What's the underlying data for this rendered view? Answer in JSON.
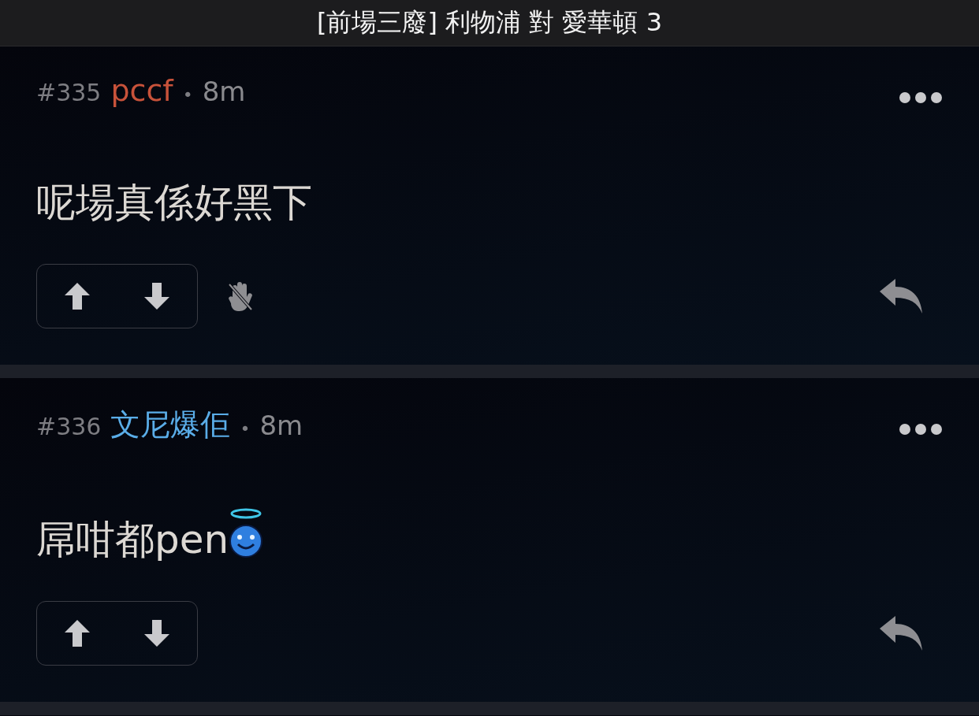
{
  "window": {
    "title": "[前場三廢] 利物浦 對 愛華頓 3"
  },
  "posts": [
    {
      "number": "#335",
      "author": "pccf",
      "color": "#c8523a",
      "separator": "•",
      "time": "8m",
      "text": "呢場真係好黑下",
      "emoji": false,
      "hand_blocked": true
    },
    {
      "number": "#336",
      "author": "文尼爆佢",
      "color": "#5aade8",
      "separator": "•",
      "time": "8m",
      "text": "屌咁都pen",
      "emoji": true,
      "hand_blocked": false
    }
  ]
}
